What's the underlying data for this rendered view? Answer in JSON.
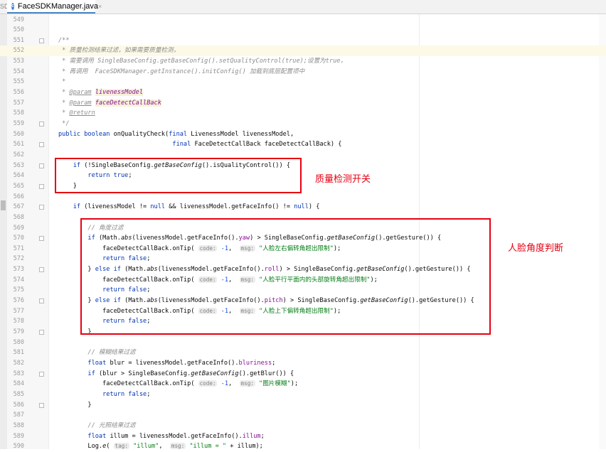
{
  "tab": {
    "stub": "SD",
    "title": "FaceSDKManager.java",
    "file_icon": "c-class-icon",
    "close_glyph": "×"
  },
  "lines": [
    {
      "num": "549",
      "fold": false,
      "hl": false,
      "segs": []
    },
    {
      "num": "550",
      "fold": false,
      "hl": false,
      "segs": []
    },
    {
      "num": "551",
      "fold": true,
      "hl": false,
      "segs": [
        {
          "c": "c",
          "t": "/**"
        }
      ]
    },
    {
      "num": "552",
      "fold": false,
      "hl": true,
      "segs": [
        {
          "c": "c",
          "t": " * 质量检测结果过滤，如果需要质量检测，"
        }
      ]
    },
    {
      "num": "553",
      "fold": false,
      "hl": false,
      "segs": [
        {
          "c": "c",
          "t": " * 需要调用 SingleBaseConfig.getBaseConfig().setQualityControl(true);设置为true，"
        }
      ]
    },
    {
      "num": "554",
      "fold": false,
      "hl": false,
      "segs": [
        {
          "c": "c",
          "t": " * 再调用  FaceSDKManager.getInstance().initConfig() 加载到底层配置项中"
        }
      ]
    },
    {
      "num": "555",
      "fold": false,
      "hl": false,
      "segs": [
        {
          "c": "c",
          "t": " *"
        }
      ]
    },
    {
      "num": "556",
      "fold": false,
      "hl": false,
      "segs": [
        {
          "c": "c",
          "t": " * "
        },
        {
          "c": "tag",
          "t": "@param"
        },
        {
          "c": "c",
          "t": " "
        },
        {
          "c": "pr",
          "t": "livenessModel"
        }
      ]
    },
    {
      "num": "557",
      "fold": false,
      "hl": false,
      "segs": [
        {
          "c": "c",
          "t": " * "
        },
        {
          "c": "tag",
          "t": "@param"
        },
        {
          "c": "c",
          "t": " "
        },
        {
          "c": "pr",
          "t": "faceDetectCallBack"
        }
      ]
    },
    {
      "num": "558",
      "fold": false,
      "hl": false,
      "segs": [
        {
          "c": "c",
          "t": " * "
        },
        {
          "c": "tag",
          "t": "@return"
        }
      ]
    },
    {
      "num": "559",
      "fold": true,
      "hl": false,
      "segs": [
        {
          "c": "c",
          "t": " */"
        }
      ]
    },
    {
      "num": "560",
      "fold": false,
      "hl": false,
      "segs": [
        {
          "c": "k",
          "t": "public boolean "
        },
        {
          "c": "",
          "t": "onQualityCheck("
        },
        {
          "c": "k",
          "t": "final "
        },
        {
          "c": "",
          "t": "LivenessModel livenessModel,"
        }
      ]
    },
    {
      "num": "561",
      "fold": true,
      "hl": false,
      "segs": [
        {
          "c": "",
          "t": "                               "
        },
        {
          "c": "k",
          "t": "final "
        },
        {
          "c": "",
          "t": "FaceDetectCallBack faceDetectCallBack) {"
        }
      ]
    },
    {
      "num": "562",
      "fold": false,
      "hl": false,
      "segs": []
    },
    {
      "num": "563",
      "fold": true,
      "hl": false,
      "segs": [
        {
          "c": "",
          "t": "    "
        },
        {
          "c": "k",
          "t": "if "
        },
        {
          "c": "",
          "t": "(!SingleBaseConfig."
        },
        {
          "c": "i",
          "t": "getBaseConfig"
        },
        {
          "c": "",
          "t": "().isQualityControl()) {"
        }
      ]
    },
    {
      "num": "564",
      "fold": false,
      "hl": false,
      "segs": [
        {
          "c": "",
          "t": "        "
        },
        {
          "c": "k",
          "t": "return true"
        },
        {
          "c": "",
          "t": ";"
        }
      ]
    },
    {
      "num": "565",
      "fold": true,
      "hl": false,
      "segs": [
        {
          "c": "",
          "t": "    }"
        }
      ]
    },
    {
      "num": "566",
      "fold": false,
      "hl": false,
      "segs": []
    },
    {
      "num": "567",
      "fold": true,
      "hl": false,
      "segs": [
        {
          "c": "",
          "t": "    "
        },
        {
          "c": "k",
          "t": "if "
        },
        {
          "c": "",
          "t": "(livenessModel != "
        },
        {
          "c": "k",
          "t": "null "
        },
        {
          "c": "",
          "t": "&& livenessModel.getFaceInfo() != "
        },
        {
          "c": "k",
          "t": "null"
        },
        {
          "c": "",
          "t": ") {"
        }
      ]
    },
    {
      "num": "568",
      "fold": false,
      "hl": false,
      "segs": []
    },
    {
      "num": "569",
      "fold": false,
      "hl": false,
      "segs": [
        {
          "c": "",
          "t": "        "
        },
        {
          "c": "c",
          "t": "// 角度过滤"
        }
      ]
    },
    {
      "num": "570",
      "fold": true,
      "hl": false,
      "segs": [
        {
          "c": "",
          "t": "        "
        },
        {
          "c": "k",
          "t": "if "
        },
        {
          "c": "",
          "t": "(Math."
        },
        {
          "c": "i",
          "t": "abs"
        },
        {
          "c": "",
          "t": "(livenessModel.getFaceInfo()."
        },
        {
          "c": "f",
          "t": "yaw"
        },
        {
          "c": "",
          "t": ") > SingleBaseConfig."
        },
        {
          "c": "i",
          "t": "getBaseConfig"
        },
        {
          "c": "",
          "t": "().getGesture()) {"
        }
      ]
    },
    {
      "num": "571",
      "fold": false,
      "hl": false,
      "segs": [
        {
          "c": "",
          "t": "            faceDetectCallBack.onTip( "
        },
        {
          "c": "hint",
          "t": "code:"
        },
        {
          "c": "",
          "t": " "
        },
        {
          "c": "n",
          "t": "-1"
        },
        {
          "c": "",
          "t": ",  "
        },
        {
          "c": "hint",
          "t": "msg:"
        },
        {
          "c": "",
          "t": " "
        },
        {
          "c": "s",
          "t": "\"人脸左右偏转角超出限制\""
        },
        {
          "c": "",
          "t": ");"
        }
      ]
    },
    {
      "num": "572",
      "fold": false,
      "hl": false,
      "segs": [
        {
          "c": "",
          "t": "            "
        },
        {
          "c": "k",
          "t": "return false"
        },
        {
          "c": "",
          "t": ";"
        }
      ]
    },
    {
      "num": "573",
      "fold": true,
      "hl": false,
      "segs": [
        {
          "c": "",
          "t": "        } "
        },
        {
          "c": "k",
          "t": "else if "
        },
        {
          "c": "",
          "t": "(Math."
        },
        {
          "c": "i",
          "t": "abs"
        },
        {
          "c": "",
          "t": "(livenessModel.getFaceInfo()."
        },
        {
          "c": "f",
          "t": "roll"
        },
        {
          "c": "",
          "t": ") > SingleBaseConfig."
        },
        {
          "c": "i",
          "t": "getBaseConfig"
        },
        {
          "c": "",
          "t": "().getGesture()) {"
        }
      ]
    },
    {
      "num": "574",
      "fold": false,
      "hl": false,
      "segs": [
        {
          "c": "",
          "t": "            faceDetectCallBack.onTip( "
        },
        {
          "c": "hint",
          "t": "code:"
        },
        {
          "c": "",
          "t": " "
        },
        {
          "c": "n",
          "t": "-1"
        },
        {
          "c": "",
          "t": ",  "
        },
        {
          "c": "hint",
          "t": "msg:"
        },
        {
          "c": "",
          "t": " "
        },
        {
          "c": "s",
          "t": "\"人脸平行平面内的头部旋转角超出限制\""
        },
        {
          "c": "",
          "t": ");"
        }
      ]
    },
    {
      "num": "575",
      "fold": false,
      "hl": false,
      "segs": [
        {
          "c": "",
          "t": "            "
        },
        {
          "c": "k",
          "t": "return false"
        },
        {
          "c": "",
          "t": ";"
        }
      ]
    },
    {
      "num": "576",
      "fold": true,
      "hl": false,
      "segs": [
        {
          "c": "",
          "t": "        } "
        },
        {
          "c": "k",
          "t": "else if "
        },
        {
          "c": "",
          "t": "(Math."
        },
        {
          "c": "i",
          "t": "abs"
        },
        {
          "c": "",
          "t": "(livenessModel.getFaceInfo()."
        },
        {
          "c": "f",
          "t": "pitch"
        },
        {
          "c": "",
          "t": ") > SingleBaseConfig."
        },
        {
          "c": "i",
          "t": "getBaseConfig"
        },
        {
          "c": "",
          "t": "().getGesture()) {"
        }
      ]
    },
    {
      "num": "577",
      "fold": false,
      "hl": false,
      "segs": [
        {
          "c": "",
          "t": "            faceDetectCallBack.onTip( "
        },
        {
          "c": "hint",
          "t": "code:"
        },
        {
          "c": "",
          "t": " "
        },
        {
          "c": "n",
          "t": "-1"
        },
        {
          "c": "",
          "t": ",  "
        },
        {
          "c": "hint",
          "t": "msg:"
        },
        {
          "c": "",
          "t": " "
        },
        {
          "c": "s",
          "t": "\"人脸上下偏转角超出限制\""
        },
        {
          "c": "",
          "t": ");"
        }
      ]
    },
    {
      "num": "578",
      "fold": false,
      "hl": false,
      "segs": [
        {
          "c": "",
          "t": "            "
        },
        {
          "c": "k",
          "t": "return false"
        },
        {
          "c": "",
          "t": ";"
        }
      ]
    },
    {
      "num": "579",
      "fold": true,
      "hl": false,
      "segs": [
        {
          "c": "",
          "t": "        }"
        }
      ]
    },
    {
      "num": "580",
      "fold": false,
      "hl": false,
      "segs": []
    },
    {
      "num": "581",
      "fold": false,
      "hl": false,
      "segs": [
        {
          "c": "",
          "t": "        "
        },
        {
          "c": "c",
          "t": "// 模糊结果过滤"
        }
      ]
    },
    {
      "num": "582",
      "fold": false,
      "hl": false,
      "segs": [
        {
          "c": "",
          "t": "        "
        },
        {
          "c": "k",
          "t": "float "
        },
        {
          "c": "",
          "t": "blur = livenessModel.getFaceInfo()."
        },
        {
          "c": "f",
          "t": "bluriness"
        },
        {
          "c": "",
          "t": ";"
        }
      ]
    },
    {
      "num": "583",
      "fold": true,
      "hl": false,
      "segs": [
        {
          "c": "",
          "t": "        "
        },
        {
          "c": "k",
          "t": "if "
        },
        {
          "c": "",
          "t": "(blur > SingleBaseConfig."
        },
        {
          "c": "i",
          "t": "getBaseConfig"
        },
        {
          "c": "",
          "t": "().getBlur()) {"
        }
      ]
    },
    {
      "num": "584",
      "fold": false,
      "hl": false,
      "segs": [
        {
          "c": "",
          "t": "            faceDetectCallBack.onTip( "
        },
        {
          "c": "hint",
          "t": "code:"
        },
        {
          "c": "",
          "t": " "
        },
        {
          "c": "n",
          "t": "-1"
        },
        {
          "c": "",
          "t": ",  "
        },
        {
          "c": "hint",
          "t": "msg:"
        },
        {
          "c": "",
          "t": " "
        },
        {
          "c": "s",
          "t": "\"图片模糊\""
        },
        {
          "c": "",
          "t": ");"
        }
      ]
    },
    {
      "num": "585",
      "fold": false,
      "hl": false,
      "segs": [
        {
          "c": "",
          "t": "            "
        },
        {
          "c": "k",
          "t": "return false"
        },
        {
          "c": "",
          "t": ";"
        }
      ]
    },
    {
      "num": "586",
      "fold": true,
      "hl": false,
      "segs": [
        {
          "c": "",
          "t": "        }"
        }
      ]
    },
    {
      "num": "587",
      "fold": false,
      "hl": false,
      "segs": []
    },
    {
      "num": "588",
      "fold": false,
      "hl": false,
      "segs": [
        {
          "c": "",
          "t": "        "
        },
        {
          "c": "c",
          "t": "// 光照结果过滤"
        }
      ]
    },
    {
      "num": "589",
      "fold": false,
      "hl": false,
      "segs": [
        {
          "c": "",
          "t": "        "
        },
        {
          "c": "k",
          "t": "float "
        },
        {
          "c": "",
          "t": "illum = livenessModel.getFaceInfo()."
        },
        {
          "c": "f",
          "t": "illum"
        },
        {
          "c": "",
          "t": ";"
        }
      ]
    },
    {
      "num": "590",
      "fold": false,
      "hl": false,
      "segs": [
        {
          "c": "",
          "t": "        Log."
        },
        {
          "c": "i",
          "t": "e"
        },
        {
          "c": "",
          "t": "( "
        },
        {
          "c": "hint",
          "t": "tag:"
        },
        {
          "c": "",
          "t": " "
        },
        {
          "c": "s",
          "t": "\"illum\""
        },
        {
          "c": "",
          "t": ",  "
        },
        {
          "c": "hint",
          "t": "msg:"
        },
        {
          "c": "",
          "t": " "
        },
        {
          "c": "s",
          "t": "\"illum = \""
        },
        {
          "c": "",
          "t": " + illum);"
        }
      ]
    }
  ],
  "annotations": {
    "quality": "质量检测开关",
    "angle": "人脸角度判断"
  },
  "colors": {
    "annotation": "#e60012",
    "keyword": "#0033b3",
    "comment": "#8c8c8c",
    "string": "#067d17",
    "field": "#871094",
    "number": "#1750eb"
  }
}
